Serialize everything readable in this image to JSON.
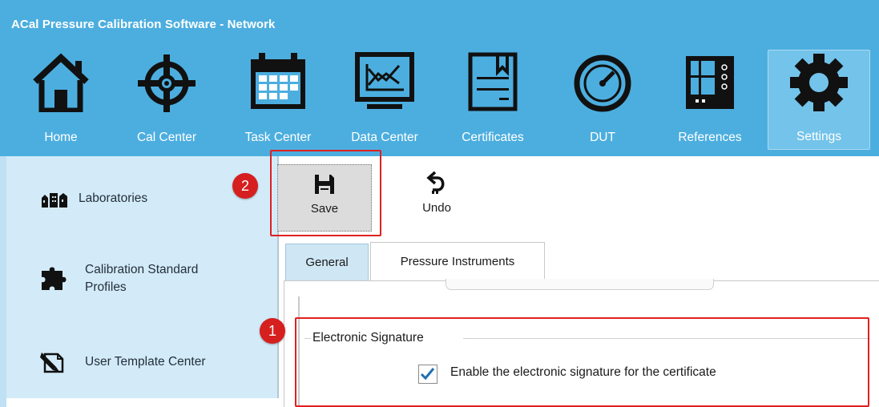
{
  "app": {
    "title": "ACal Pressure Calibration Software -  Network"
  },
  "nav": {
    "items": [
      {
        "label": "Home",
        "icon": "home-icon"
      },
      {
        "label": "Cal Center",
        "icon": "crosshair-icon"
      },
      {
        "label": "Task Center",
        "icon": "calendar-icon"
      },
      {
        "label": "Data Center",
        "icon": "chart-monitor-icon"
      },
      {
        "label": "Certificates",
        "icon": "certificate-icon"
      },
      {
        "label": "DUT",
        "icon": "gauge-icon"
      },
      {
        "label": "References",
        "icon": "reference-device-icon"
      },
      {
        "label": "Settings",
        "icon": "gear-icon",
        "active": true
      }
    ]
  },
  "sidebar": {
    "items": [
      {
        "label": "Laboratories",
        "icon": "buildings-icon"
      },
      {
        "label": "Calibration Standard Profiles",
        "line1": "Calibration Standard",
        "line2": "Profiles",
        "icon": "puzzle-icon"
      },
      {
        "label": "User Template Center",
        "icon": "template-edit-icon"
      }
    ]
  },
  "toolbar": {
    "save_label": "Save",
    "undo_label": "Undo"
  },
  "callouts": {
    "one": "1",
    "two": "2"
  },
  "tabs": [
    {
      "label": "General",
      "active": true
    },
    {
      "label": "Pressure Instruments",
      "active": false
    }
  ],
  "general": {
    "group_title": "Electronic Signature",
    "checkbox_label": "Enable the electronic signature for the certificate",
    "checkbox_checked": true
  },
  "colors": {
    "ribbon": "#4caedf",
    "sidebar": "#d3ebf8",
    "callout": "#e02020",
    "check": "#1f6fb5"
  }
}
